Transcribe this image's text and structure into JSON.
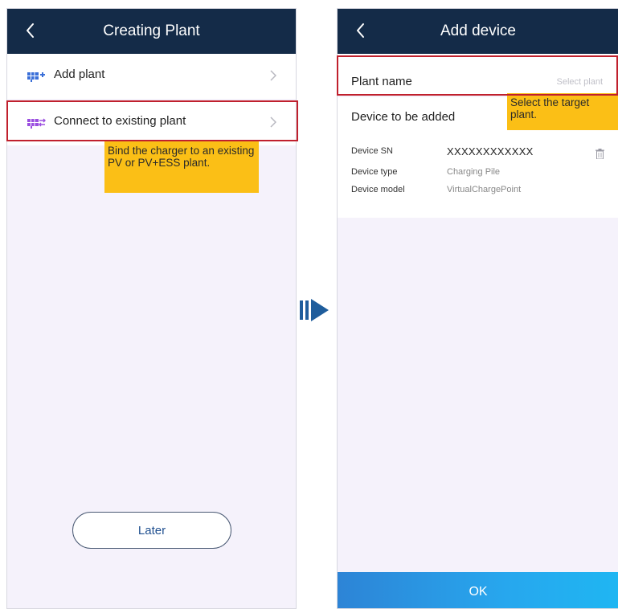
{
  "left_screen": {
    "title": "Creating Plant",
    "items": [
      {
        "label": "Add plant",
        "icon": "add-plant-icon"
      },
      {
        "label": "Connect to existing plant",
        "icon": "connect-plant-icon"
      }
    ],
    "callout": "Bind the charger to an existing PV or PV+ESS plant.",
    "later_label": "Later"
  },
  "right_screen": {
    "title": "Add device",
    "plant_name_label": "Plant name",
    "plant_name_placeholder": "Select plant",
    "device_section_label": "Device to be added",
    "callout": "Select the target plant.",
    "device": {
      "sn_label": "Device SN",
      "sn_value": "XXXXXXXXXXXX",
      "type_label": "Device type",
      "type_value": "Charging Pile",
      "model_label": "Device model",
      "model_value": "VirtualChargePoint"
    },
    "ok_label": "OK"
  },
  "colors": {
    "topbar": "#142b48",
    "highlight": "#c0202d",
    "callout": "#fbbf16",
    "ok_button": "#27a7ee",
    "flow_arrow": "#1f5d9c"
  }
}
